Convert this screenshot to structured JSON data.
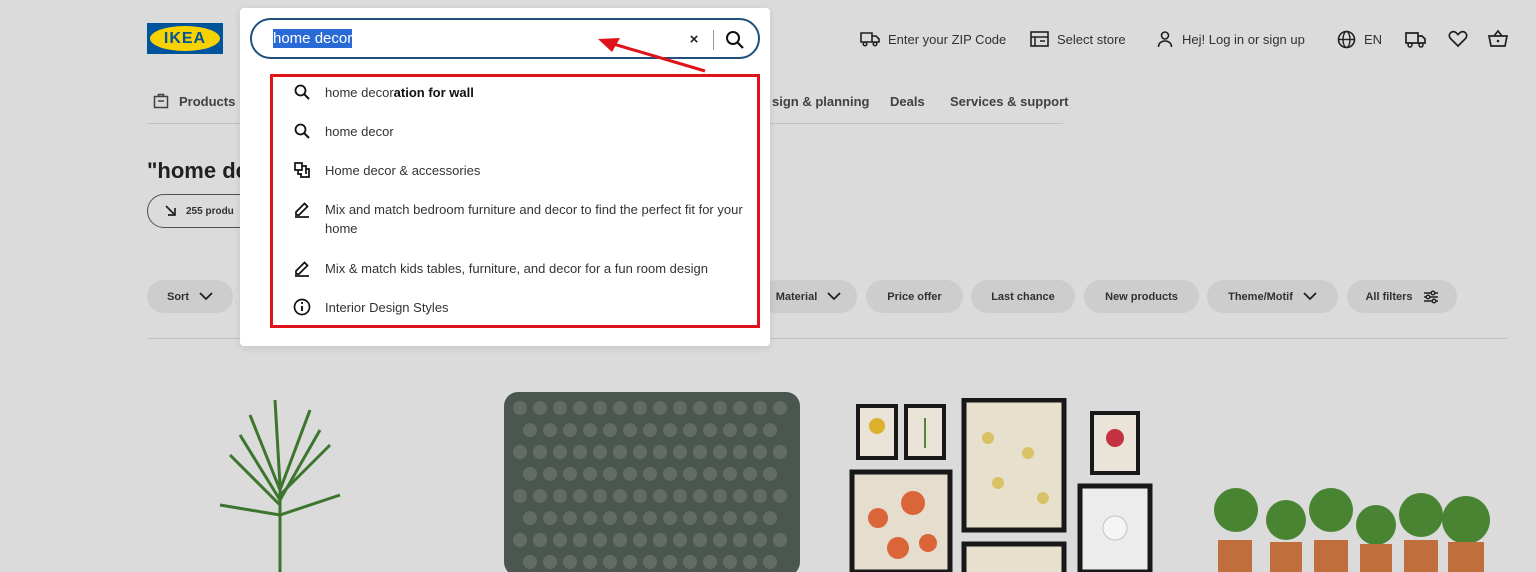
{
  "header": {
    "logo_text": "IKEA",
    "zip_label": "Enter your ZIP Code",
    "store_label": "Select store",
    "login_label": "Hej! Log in or sign up",
    "lang_label": "EN"
  },
  "nav": {
    "products": "Products",
    "design": "sign & planning",
    "deals": "Deals",
    "services": "Services & support"
  },
  "results": {
    "heading": "\"home de",
    "count": "255 produ"
  },
  "filters": {
    "sort": "Sort",
    "material": "Material",
    "price_offer": "Price offer",
    "last_chance": "Last chance",
    "new_products": "New products",
    "theme": "Theme/Motif",
    "all_filters": "All filters"
  },
  "search": {
    "query": "home decor",
    "suggestions": [
      {
        "icon": "search-icon",
        "prefix": "home decor",
        "bold": "ation for wall"
      },
      {
        "icon": "search-icon",
        "text": "home decor"
      },
      {
        "icon": "category-icon",
        "text": "Home decor & accessories"
      },
      {
        "icon": "pencil-icon",
        "text": "Mix and match bedroom furniture and decor to find the perfect fit for your home"
      },
      {
        "icon": "pencil-icon",
        "text": "Mix & match kids tables, furniture, and decor for a fun room design"
      },
      {
        "icon": "info-icon",
        "text": "Interior Design Styles"
      }
    ]
  },
  "annotation_color": "#e0131b",
  "brand_colors": {
    "blue": "#0058a3",
    "yellow": "#ffdb00"
  }
}
